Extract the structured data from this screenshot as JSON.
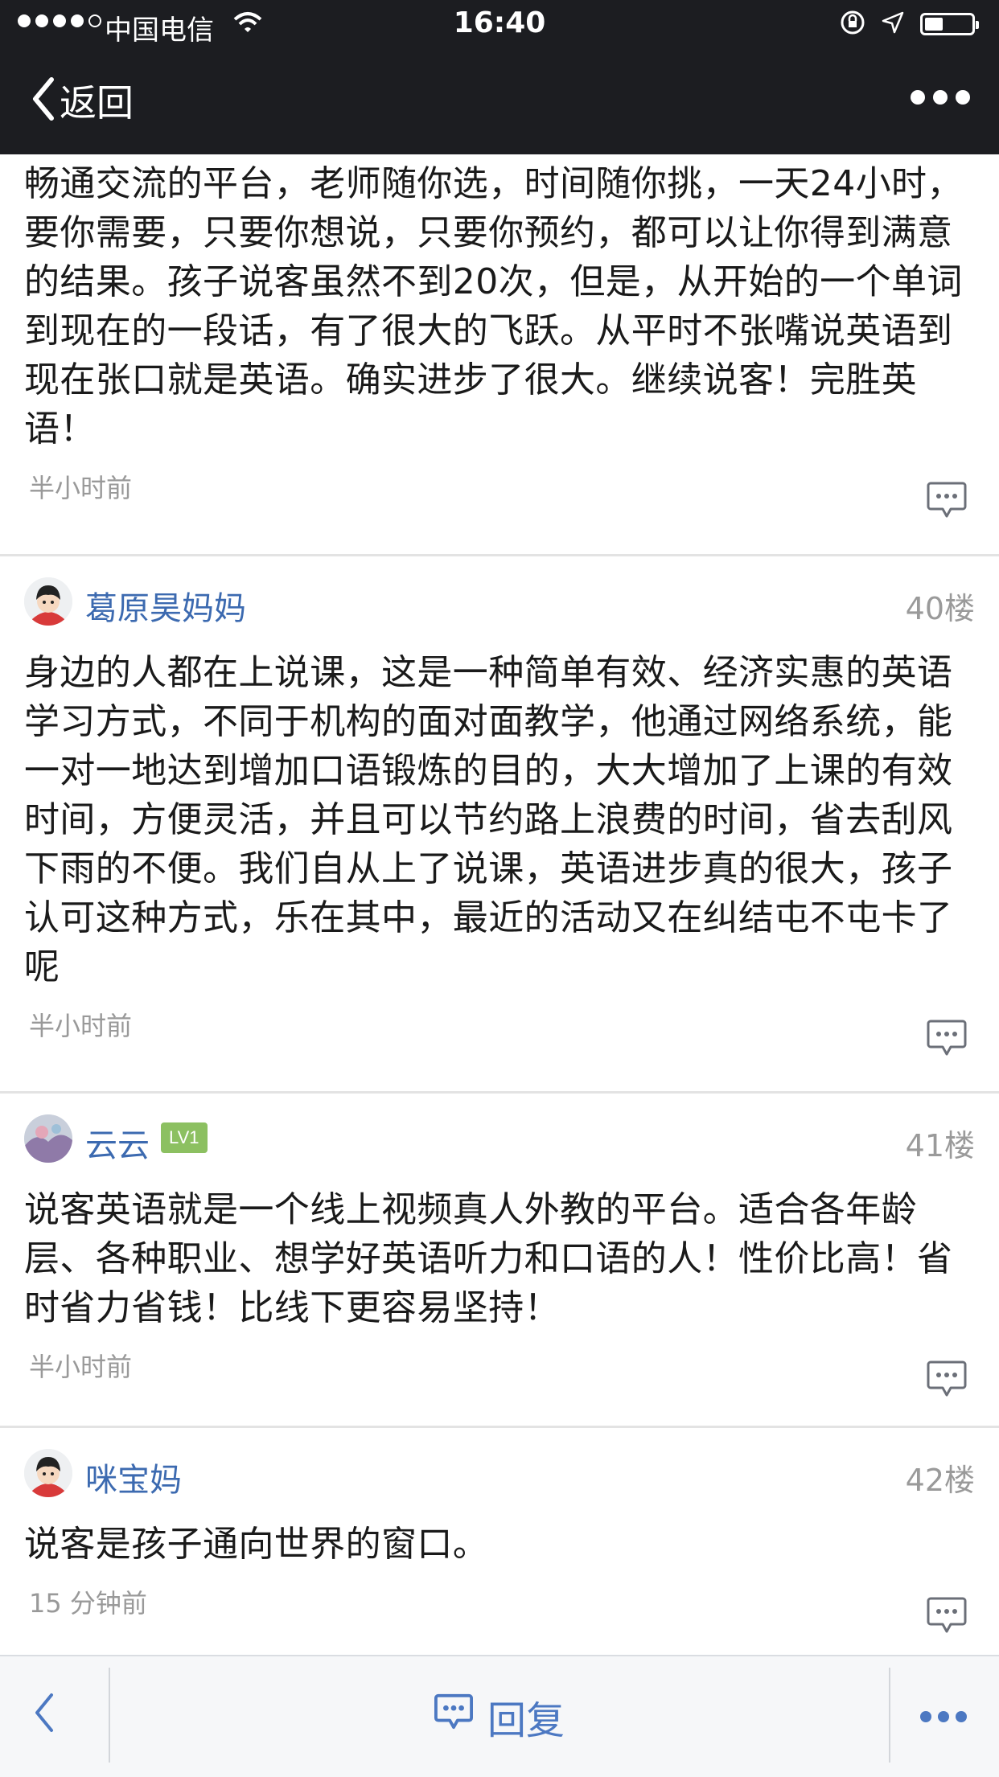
{
  "status_bar": {
    "carrier": "中国电信",
    "time": "16:40"
  },
  "nav": {
    "back_label": "返回"
  },
  "posts": [
    {
      "partial": true,
      "body": "畅通交流的平台，老师随你选，时间随你挑，一天24小时，要你需要，只要你想说，只要你预约，都可以让你得到满意的结果。孩子说客虽然不到20次，但是，从开始的一个单词到现在的一段话，有了很大的飞跃。从平时不张嘴说英语到现在张口就是英语。确实进步了很大。继续说客！完胜英语！",
      "time": "半小时前"
    },
    {
      "username": "葛原昊妈妈",
      "floor": "40楼",
      "body": "身边的人都在上说课，这是一种简单有效、经济实惠的英语学习方式，不同于机构的面对面教学，他通过网络系统，能一对一地达到增加口语锻炼的目的，大大增加了上课的有效时间，方便灵活，并且可以节约路上浪费的时间，省去刮风下雨的不便。我们自从上了说课，英语进步真的很大，孩子认可这种方式，乐在其中，最近的活动又在纠结屯不屯卡了呢",
      "time": "半小时前"
    },
    {
      "username": "云云",
      "badge": "LV1",
      "floor": "41楼",
      "body": "说客英语就是一个线上视频真人外教的平台。适合各年龄层、各种职业、想学好英语听力和口语的人！性价比高！省时省力省钱！比线下更容易坚持！",
      "time": "半小时前"
    },
    {
      "username": "咪宝妈",
      "floor": "42楼",
      "body": "说客是孩子通向世界的窗口。",
      "time": "15 分钟前"
    }
  ],
  "toolbar": {
    "reply_label": "回复"
  },
  "colors": {
    "header_bg": "#1c1d21",
    "link_blue": "#3c6ab0",
    "badge_green": "#8cc061",
    "toolbar_blue": "#4c78c2"
  }
}
